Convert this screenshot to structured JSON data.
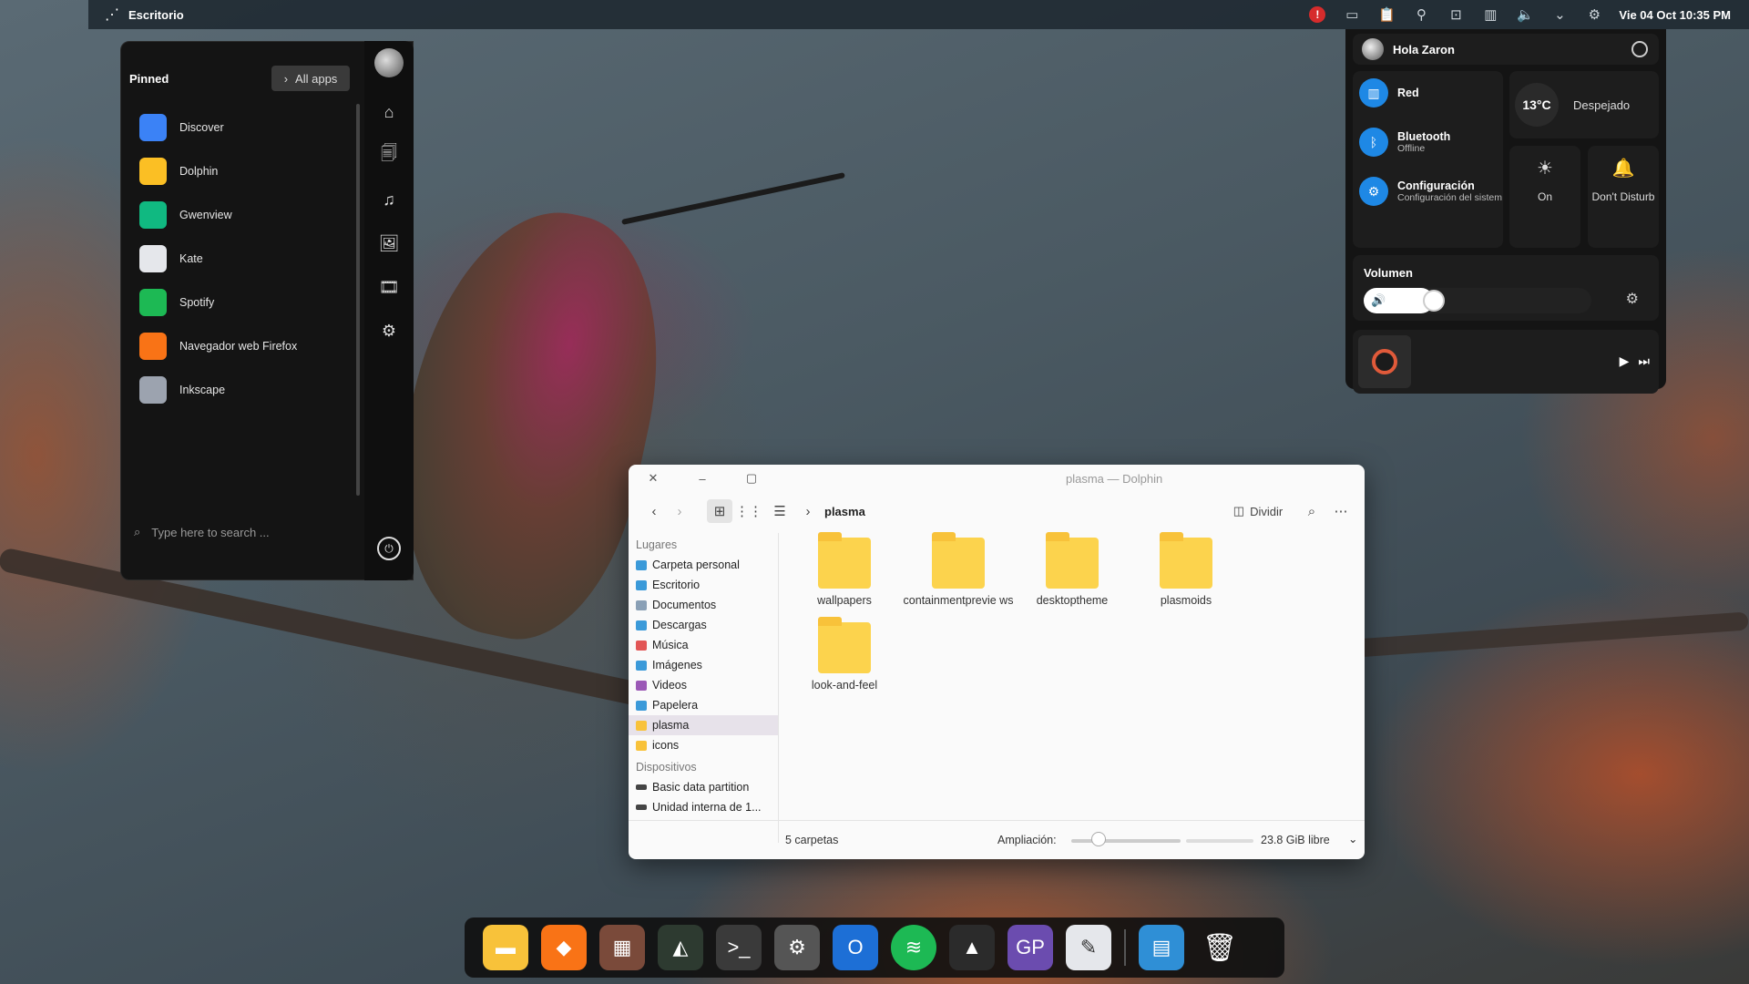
{
  "topbar": {
    "title": "Escritorio",
    "clock": "Vie 04 Oct  10:35 PM",
    "tray_icons": [
      "alert-icon",
      "display-icon",
      "clipboard-icon",
      "location-icon",
      "input-icon",
      "network-icon",
      "volume-icon",
      "chevron-down-icon",
      "settings-icon"
    ]
  },
  "start_menu": {
    "pinned_label": "Pinned",
    "all_apps_label": "All apps",
    "apps": [
      {
        "name": "Discover",
        "icon": "discover-icon",
        "color": "#3b82f6"
      },
      {
        "name": "Dolphin",
        "icon": "dolphin-icon",
        "color": "#fbbf24"
      },
      {
        "name": "Gwenview",
        "icon": "gwenview-icon",
        "color": "#10b981"
      },
      {
        "name": "Kate",
        "icon": "kate-icon",
        "color": "#e5e7eb"
      },
      {
        "name": "Spotify",
        "icon": "spotify-icon",
        "color": "#1db954"
      },
      {
        "name": "Navegador web Firefox",
        "icon": "firefox-icon",
        "color": "#f97316"
      },
      {
        "name": "Inkscape",
        "icon": "inkscape-icon",
        "color": "#9ca3af"
      }
    ],
    "search_placeholder": "Type here to search ..."
  },
  "quick_settings": {
    "greeting": "Hola Zaron",
    "network_label": "Red",
    "bluetooth_label": "Bluetooth",
    "bluetooth_status": "Offline",
    "config_label": "Configuración",
    "config_sub": "Configuración del sistem",
    "temperature": "13°C",
    "weather": "Despejado",
    "night_light_label": "On",
    "dnd_label": "Don't Disturb",
    "volume_title": "Volumen",
    "volume_level": 0.25
  },
  "dolphin": {
    "title": "plasma — Dolphin",
    "breadcrumb": "plasma",
    "split_label": "Dividir",
    "places_header": "Lugares",
    "places": [
      {
        "label": "Carpeta personal",
        "color": "#3b9ad9"
      },
      {
        "label": "Escritorio",
        "color": "#3b9ad9"
      },
      {
        "label": "Documentos",
        "color": "#8aa0b6"
      },
      {
        "label": "Descargas",
        "color": "#3b9ad9"
      },
      {
        "label": "Música",
        "color": "#e25656"
      },
      {
        "label": "Imágenes",
        "color": "#3b9ad9"
      },
      {
        "label": "Videos",
        "color": "#9b59b6"
      },
      {
        "label": "Papelera",
        "color": "#3b9ad9"
      },
      {
        "label": "plasma",
        "color": "#f8c23a"
      },
      {
        "label": "icons",
        "color": "#f8c23a"
      }
    ],
    "devices_header": "Dispositivos",
    "devices": [
      {
        "label": "Basic data partition"
      },
      {
        "label": "Unidad interna de 1..."
      }
    ],
    "folders": [
      "wallpapers",
      "containmentprevie ws",
      "desktoptheme",
      "plasmoids",
      "look-and-feel"
    ],
    "status_count": "5 carpetas",
    "zoom_label": "Ampliación:",
    "free_space": "23.8 GiB libre"
  },
  "dock": {
    "apps": [
      "dolphin-icon",
      "firefox-icon",
      "discover-icon",
      "gwenview-icon",
      "terminal-icon",
      "settings-icon",
      "outlook-icon",
      "spotify-icon",
      "inkscape-icon",
      "gimp-icon",
      "kate-icon",
      "calculator-icon",
      "trash-icon"
    ]
  }
}
